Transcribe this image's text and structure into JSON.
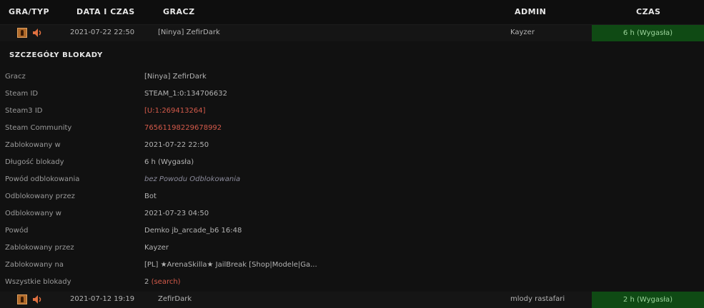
{
  "header": {
    "col_game": "GRA/TYP",
    "col_date": "DATA I CZAS",
    "col_player": "GRACZ",
    "col_admin": "ADMIN",
    "col_time": "CZAS"
  },
  "rows": [
    {
      "date": "2021-07-22 22:50",
      "player": "[Ninya] ZefirDark",
      "admin": "Kayzer",
      "time": "6 h (Wygasła)",
      "game_icon": "counter-strike-icon",
      "type_icon": "speaker-muted-icon"
    },
    {
      "date": "2021-07-12 19:19",
      "player": "ZefirDark",
      "admin": "mlody rastafari",
      "time": "2 h (Wygasła)",
      "game_icon": "counter-strike-icon",
      "type_icon": "speaker-muted-icon"
    }
  ],
  "details": {
    "title": "SZCZEGÓŁY BLOKADY",
    "player_label": "Gracz",
    "player_value": "[Ninya] ZefirDark",
    "steamid_label": "Steam ID",
    "steamid_value": "STEAM_1:0:134706632",
    "steam3_label": "Steam3 ID",
    "steam3_value": "[U:1:269413264]",
    "community_label": "Steam Community",
    "community_value": "76561198229678992",
    "banned_on_label": "Zablokowany w",
    "banned_on_value": "2021-07-22 22:50",
    "length_label": "Długość blokady",
    "length_value": "6 h (Wygasła)",
    "unban_reason_label": "Powód odblokowania",
    "unban_reason_value": "bez Powodu Odblokowania",
    "unbanned_by_label": "Odblokowany przez",
    "unbanned_by_value": "Bot",
    "unbanned_on_label": "Odblokowany w",
    "unbanned_on_value": "2021-07-23 04:50",
    "reason_label": "Powód",
    "reason_value": "Demko jb_arcade_b6 16:48",
    "banned_by_label": "Zablokowany przez",
    "banned_by_value": "Kayzer",
    "banned_on_server_label": "Zablokowany na",
    "banned_on_server_value": "[PL] ★ArenaSkilla★ JailBreak [Shop|Modele|Ga...",
    "all_bans_label": "Wszystkie blokady",
    "all_bans_count": "2",
    "all_bans_link": "(search)"
  },
  "colors": {
    "background": "#111111",
    "expired_cell": "#0f4a14",
    "link_red": "#d45a4a"
  }
}
